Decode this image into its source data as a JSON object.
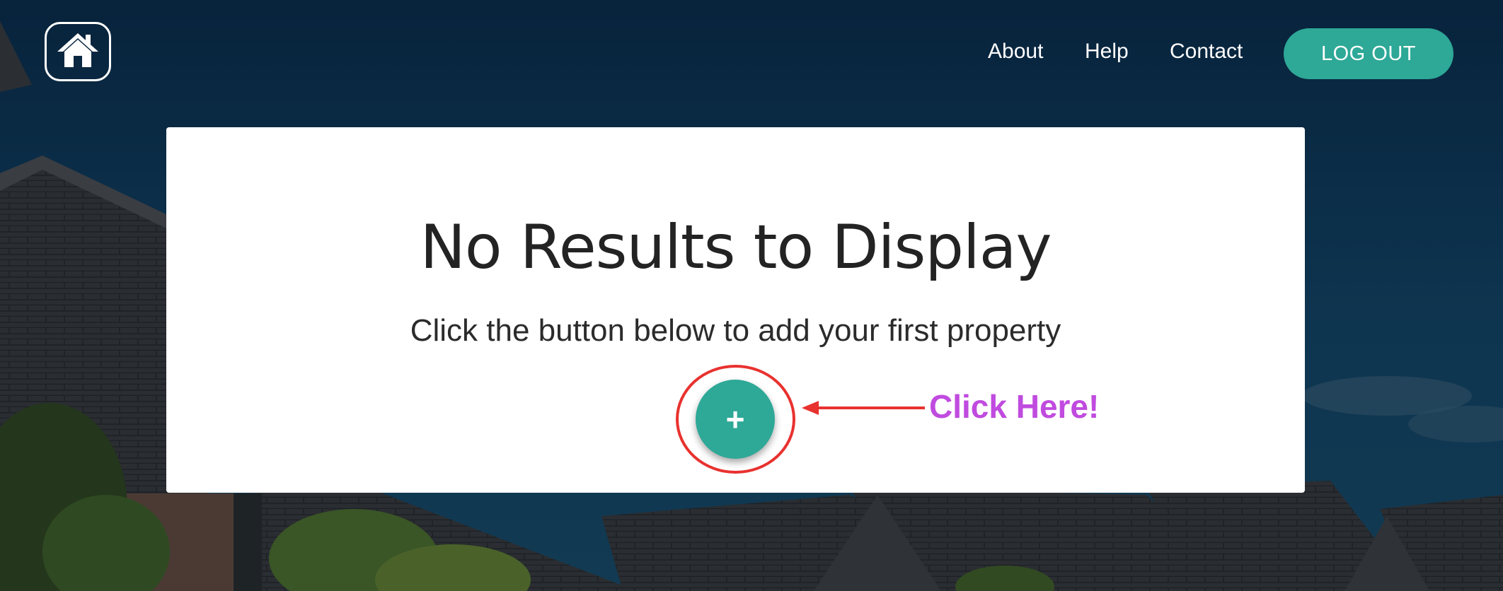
{
  "nav": {
    "home_icon": "house-icon",
    "links": [
      "About",
      "Help",
      "Contact"
    ],
    "logout_label": "LOG OUT"
  },
  "main": {
    "title": "No Results to Display",
    "subtitle": "Click the button below to add your first property",
    "add_button_label": "+",
    "add_icon": "plus-icon"
  },
  "annotation": {
    "callout_text": "Click Here!",
    "ring_color": "#e8322f",
    "callout_color": "#c04bdf"
  },
  "colors": {
    "accent": "#2ea897",
    "background": "#0b2842"
  }
}
